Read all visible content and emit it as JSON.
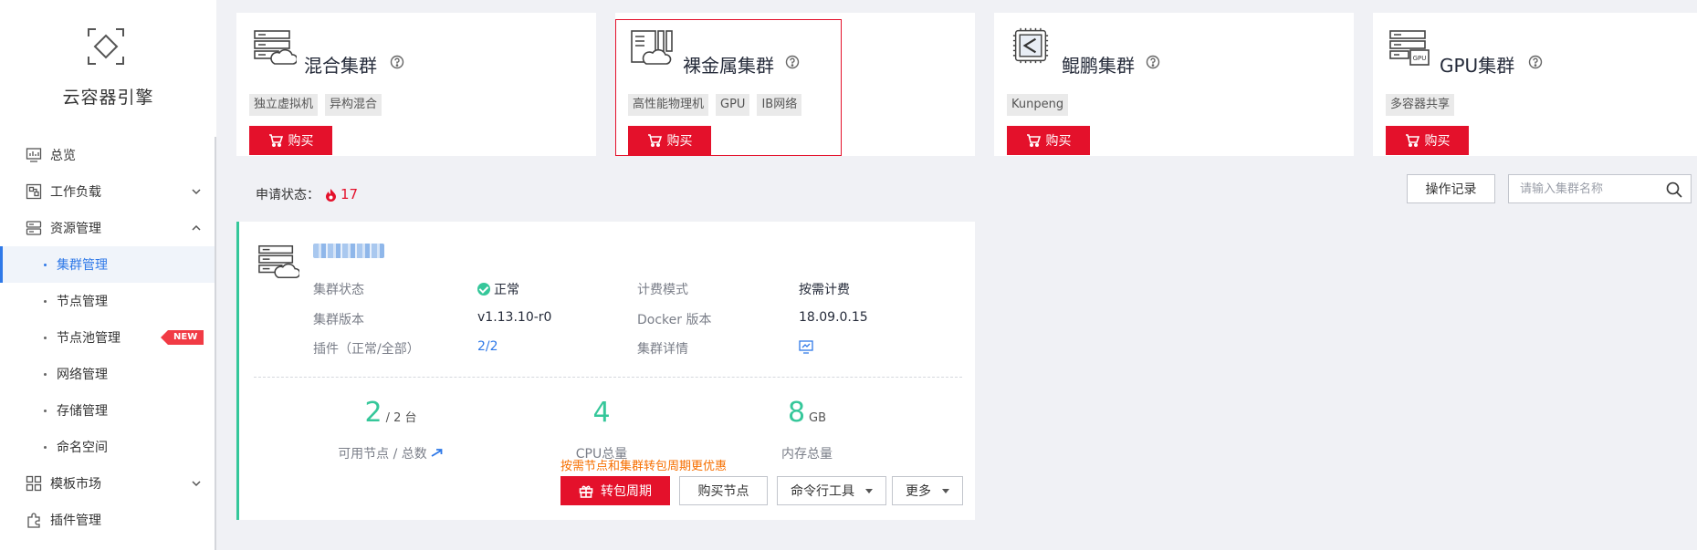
{
  "sidebar": {
    "brand_title": "云容器引擎",
    "items": [
      {
        "label": "总览"
      },
      {
        "label": "工作负载"
      },
      {
        "label": "资源管理"
      },
      {
        "label": "模板市场"
      },
      {
        "label": "插件管理"
      }
    ],
    "sub_items": [
      {
        "label": "集群管理",
        "active": true
      },
      {
        "label": "节点管理"
      },
      {
        "label": "节点池管理",
        "badge": "NEW"
      },
      {
        "label": "网络管理"
      },
      {
        "label": "存储管理"
      },
      {
        "label": "命名空间"
      }
    ]
  },
  "cluster_types": [
    {
      "name": "混合集群",
      "tags": [
        "独立虚拟机",
        "异构混合"
      ],
      "buy_label": "购买",
      "icon": "hybrid-cluster-icon"
    },
    {
      "name": "裸金属集群",
      "tags": [
        "高性能物理机",
        "GPU",
        "IB网络"
      ],
      "buy_label": "购买",
      "icon": "bare-metal-cluster-icon",
      "selected": true
    },
    {
      "name": "鲲鹏集群",
      "tags": [
        "Kunpeng"
      ],
      "buy_label": "购买",
      "icon": "kunpeng-chip-icon"
    },
    {
      "name": "GPU集群",
      "tags": [
        "多容器共享"
      ],
      "buy_label": "购买",
      "icon": "gpu-cluster-icon"
    }
  ],
  "status_bar": {
    "apply_label": "申请状态：",
    "apply_count": "17",
    "op_record_label": "操作记录",
    "search_placeholder": "请输入集群名称"
  },
  "cluster": {
    "name": "kvm-test",
    "fields": {
      "status_label": "集群状态",
      "status_value": "正常",
      "billing_label": "计费模式",
      "billing_value": "按需计费",
      "version_label": "集群版本",
      "version_value": "v1.13.10-r0",
      "docker_label": "Docker 版本",
      "docker_value": "18.09.0.15",
      "addon_label": "插件（正常/全部）",
      "addon_value": "2/2",
      "detail_label": "集群详情"
    },
    "stats": {
      "nodes_available": "2",
      "nodes_total_text": "/ 2 台",
      "nodes_label": "可用节点 / 总数",
      "cpu_value": "4",
      "cpu_label": "CPU总量",
      "mem_value": "8",
      "mem_unit": "GB",
      "mem_label": "内存总量"
    },
    "promo_text": "按需节点和集群转包周期更优惠",
    "actions": {
      "convert_label": "转包周期",
      "buy_node_label": "购买节点",
      "cli_label": "命令行工具",
      "more_label": "更多"
    }
  },
  "colors": {
    "primary_red": "#e4112b",
    "accent_blue": "#2f79e8",
    "success_green": "#35c79a",
    "promo_orange": "#f66f00"
  }
}
